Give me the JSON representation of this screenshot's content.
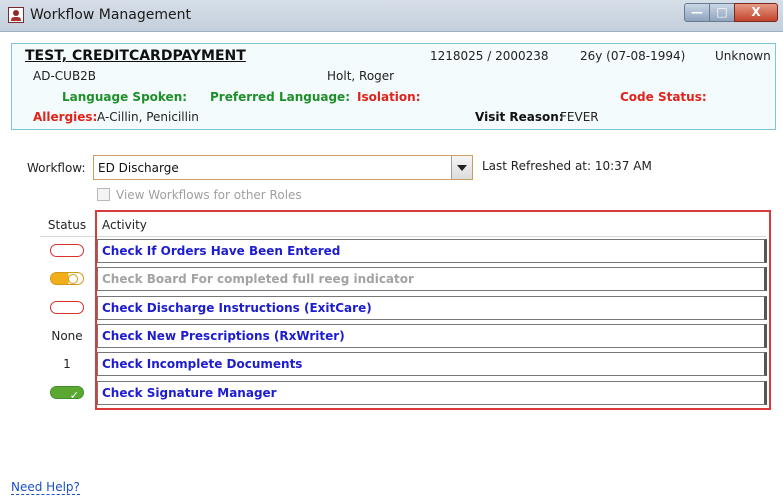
{
  "window": {
    "title": "Workflow Management",
    "controls": {
      "minimize": "—",
      "maximize": "□",
      "close": "X"
    }
  },
  "patient": {
    "name": "TEST, CREDITCARDPAYMENT",
    "account": "1218025 / 2000238",
    "age_dob": "26y (07-08-1994)",
    "gender": "Unknown",
    "location": "AD-CUB2B",
    "provider": "Holt, Roger",
    "language_spoken_label": "Language Spoken:",
    "preferred_language_label": "Preferred Language:",
    "isolation_label": "Isolation:",
    "code_status_label": "Code Status:",
    "allergies_label": "Allergies:",
    "allergies_value": "A-Cillin, Penicillin",
    "visit_reason_label": "Visit Reason:",
    "visit_reason_value": "FEVER"
  },
  "workflow": {
    "label": "Workflow:",
    "selected": "ED Discharge",
    "last_refreshed": "Last Refreshed at: 10:37 AM",
    "other_roles_label": "View Workflows for other Roles",
    "other_roles_checked": false
  },
  "table": {
    "headers": {
      "status": "Status",
      "activity": "Activity"
    },
    "rows": [
      {
        "status_text": "",
        "status_kind": "empty",
        "activity": "Check If Orders Have Been Entered",
        "enabled": true
      },
      {
        "status_text": "",
        "status_kind": "partial",
        "activity": "Check Board For completed full reeg indicator",
        "enabled": false
      },
      {
        "status_text": "",
        "status_kind": "empty",
        "activity": "Check Discharge Instructions (ExitCare)",
        "enabled": true
      },
      {
        "status_text": "None",
        "status_kind": "text",
        "activity": "Check New Prescriptions (RxWriter)",
        "enabled": true
      },
      {
        "status_text": "1",
        "status_kind": "text",
        "activity": "Check Incomplete Documents",
        "enabled": true
      },
      {
        "status_text": "",
        "status_kind": "done",
        "activity": "Check Signature Manager",
        "enabled": true
      }
    ]
  },
  "footer": {
    "help_link": "Need Help?"
  },
  "colors": {
    "accent_link": "#1d1dcf",
    "alert_red": "#e0231b",
    "label_green": "#1f8f2a",
    "highlight_border": "#d93a3a"
  }
}
